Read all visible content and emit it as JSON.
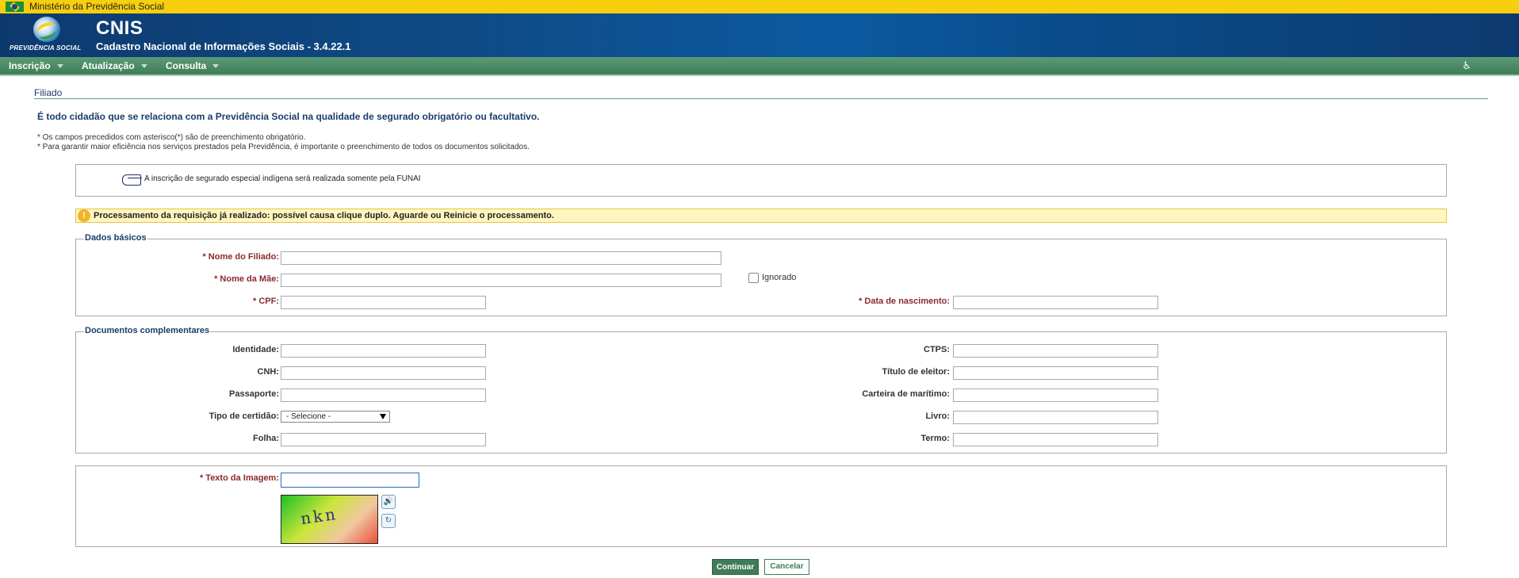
{
  "gov_bar": {
    "label": "Ministério da Previdência Social"
  },
  "header": {
    "logo_text": "PREVIDÊNCIA SOCIAL",
    "app_name": "CNIS",
    "app_subtitle": "Cadastro Nacional de Informações Sociais - 3.4.22.1"
  },
  "menu": {
    "items": [
      {
        "label": "Inscrição"
      },
      {
        "label": "Atualização"
      },
      {
        "label": "Consulta"
      }
    ],
    "accessibility_icon": "wheelchair-icon"
  },
  "page": {
    "section_title": "Filiado",
    "intro": "É todo cidadão que se relaciona com a Previdência Social na qualidade de segurado obrigatório ou facultativo.",
    "notes": [
      "* Os campos precedidos com asterisco(*) são de preenchimento obrigatório.",
      "* Para garantir maior eficiência nos serviços prestados pela Previdência, é importante o preenchimento de todos os documentos solicitados."
    ],
    "info": "A inscrição de segurado especial indígena será realizada somente pela FUNAI",
    "warning": "Processamento da requisição já realizado: possível causa clique duplo. Aguarde ou Reinicie o processamento."
  },
  "basic": {
    "legend": "Dados básicos",
    "nome_filiado_label": "* Nome do Filiado:",
    "nome_mae_label": "* Nome da Mãe:",
    "ignorado_label": "Ignorado",
    "cpf_label": "* CPF:",
    "data_nascimento_label": "* Data de nascimento:"
  },
  "docs": {
    "legend": "Documentos complementares",
    "identidade_label": "Identidade:",
    "cnh_label": "CNH:",
    "passaporte_label": "Passaporte:",
    "tipo_certidao_label": "Tipo de certidão:",
    "tipo_certidao_value": "- Selecione -",
    "folha_label": "Folha:",
    "ctps_label": "CTPS:",
    "titulo_label": "Título de eleitor:",
    "maritimo_label": "Carteira de marítimo:",
    "livro_label": "Livro:",
    "termo_label": "Termo:"
  },
  "captcha": {
    "label": "* Texto da Imagem:",
    "image_text": "nkn",
    "audio_icon": "speaker-icon",
    "refresh_icon": "refresh-icon"
  },
  "actions": {
    "continue_label": "Continuar",
    "cancel_label": "Cancelar"
  },
  "colors": {
    "gov_bar": "#f7cf0e",
    "header": "#0f4a86",
    "menu": "#4c8a64",
    "required_label": "#8a2b2b",
    "title_text": "#1a3d6b"
  }
}
